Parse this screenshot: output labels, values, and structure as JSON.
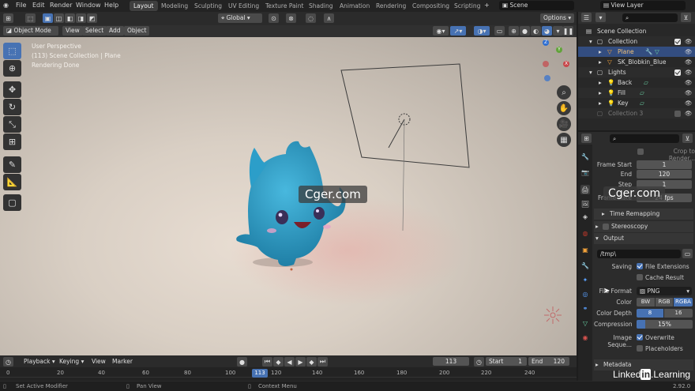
{
  "menu": {
    "file": "File",
    "edit": "Edit",
    "render": "Render",
    "window": "Window",
    "help": "Help"
  },
  "workspaces": [
    "Layout",
    "Modeling",
    "Sculpting",
    "UV Editing",
    "Texture Paint",
    "Shading",
    "Animation",
    "Rendering",
    "Compositing",
    "Scripting"
  ],
  "scene_field": "Scene",
  "view_layer_field": "View Layer",
  "viewport_header": {
    "transform_orientation": "Global",
    "options": "Options",
    "mode": "Object Mode",
    "view": "View",
    "select": "Select",
    "add": "Add",
    "object": "Object"
  },
  "viewport_overlay": {
    "line1": "User Perspective",
    "line2": "(113) Scene Collection | Plane",
    "line3": "Rendering Done"
  },
  "gizmo": {
    "z": "Z",
    "y": "Y",
    "x": "X"
  },
  "watermark": "Cger.com",
  "outliner": {
    "scene_collection": "Scene Collection",
    "collection": "Collection",
    "plane": "Plane",
    "sk": "SK_Blobkin_Blue",
    "lights": "Lights",
    "back": "Back",
    "fill": "Fill",
    "key": "Key",
    "collection3": "Collection 3"
  },
  "properties": {
    "crop": "Crop to Render...",
    "frame_start_label": "Frame Start",
    "frame_start": "1",
    "end_label": "End",
    "end": "120",
    "step_label": "Step",
    "step": "1",
    "frame_rate_label": "Frame Rate",
    "frame_rate": "24 fps",
    "time_remapping": "Time Remapping",
    "stereoscopy": "Stereoscopy",
    "output": "Output",
    "path": "/tmp\\",
    "saving_label": "Saving",
    "file_extensions": "File Extensions",
    "cache_result": "Cache Result",
    "file_format_label": "File Format",
    "file_format": "PNG",
    "color_label": "Color",
    "color_bw": "BW",
    "color_rgb": "RGB",
    "color_rgba": "RGBA",
    "color_depth_label": "Color Depth",
    "depth_8": "8",
    "depth_16": "16",
    "compression_label": "Compression",
    "compression": "15%",
    "compression_fraction": 0.15,
    "image_seq_label": "Image Seque...",
    "overwrite": "Overwrite",
    "placeholders": "Placeholders",
    "metadata": "Metadata"
  },
  "watermark2": "Cger.com",
  "linkedin": "Linked",
  "linkedin_in": "in",
  "learning": ".Learning",
  "timeline": {
    "playback": "Playback",
    "keying": "Keying",
    "view": "View",
    "marker": "Marker",
    "current_frame": "113",
    "start_label": "Start",
    "start": "1",
    "end_label": "End",
    "end": "120",
    "ticks": [
      "0",
      "20",
      "40",
      "60",
      "80",
      "100",
      "120",
      "140",
      "160",
      "180",
      "200",
      "220",
      "240"
    ],
    "playhead": "113"
  },
  "status": {
    "left": "Set Active Modifier",
    "middle": "Pan View",
    "right": "Context Menu",
    "version": "2.92.0"
  },
  "colors": {
    "accent": "#4772b3",
    "character": "#2c9ec9",
    "viewport_bg": "#d9cfc4"
  }
}
